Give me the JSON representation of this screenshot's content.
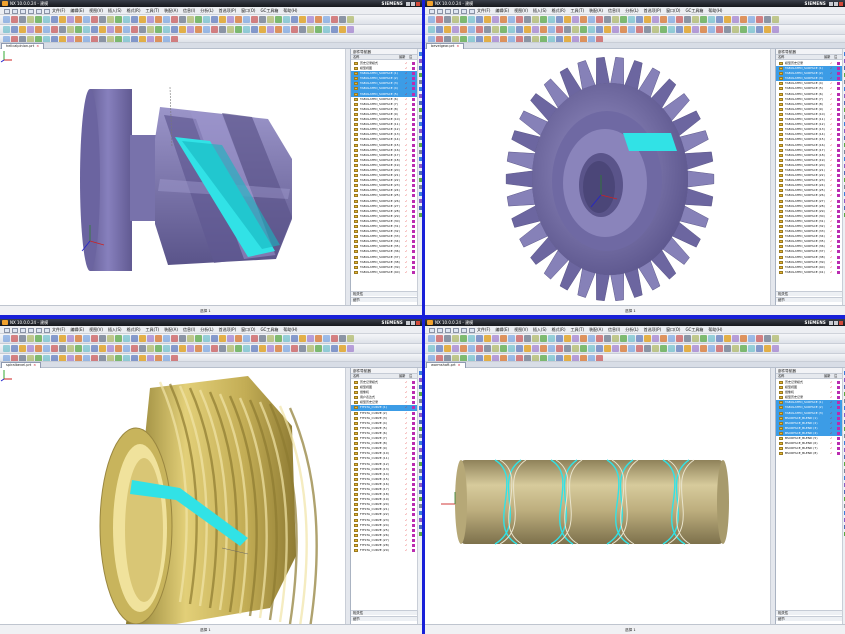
{
  "app": {
    "title": "NX 10.0.0.24 - 建模",
    "brand": "SIEMENS",
    "menus": [
      "文件(F)",
      "编辑(E)",
      "视图(V)",
      "插入(S)",
      "格式(R)",
      "工具(T)",
      "装配(A)",
      "信息(I)",
      "分析(L)",
      "首选项(P)",
      "窗口(O)",
      "GC工具箱",
      "帮助(H)"
    ]
  },
  "panels": [
    {
      "id": "helical-pinion",
      "tab": "helicalpinion.prt",
      "status_message": "",
      "status_count": "选择 1",
      "nav_header": "部件导航器",
      "nav_cols": [
        "名称",
        "最新",
        "注"
      ],
      "nav_rows": [
        {
          "label": "历史记录模式",
          "sel": false
        },
        {
          "label": "模型视图",
          "sel": false
        },
        {
          "label": "TABULATED_SURFACE (1)",
          "sel": true
        },
        {
          "label": "TABULATED_SURFACE (2)",
          "sel": true
        },
        {
          "label": "TABULATED_SURFACE (3)",
          "sel": true
        },
        {
          "label": "TABULATED_SURFACE (4)",
          "sel": true
        },
        {
          "label": "TABULATED_SURFACE (5)",
          "sel": true
        },
        {
          "label": "TABULATED_SURFACE (6)",
          "sel": false
        },
        {
          "label": "TABULATED_SURFACE (7)",
          "sel": false
        },
        {
          "label": "TABULATED_SURFACE (8)",
          "sel": false
        },
        {
          "label": "TABULATED_SURFACE (9)",
          "sel": false
        },
        {
          "label": "TABULATED_SURFACE (10)",
          "sel": false
        },
        {
          "label": "TABULATED_SURFACE (11)",
          "sel": false
        },
        {
          "label": "TABULATED_SURFACE (12)",
          "sel": false
        },
        {
          "label": "TABULATED_SURFACE (13)",
          "sel": false
        },
        {
          "label": "TABULATED_SURFACE (14)",
          "sel": false
        },
        {
          "label": "TABULATED_SURFACE (15)",
          "sel": false
        },
        {
          "label": "TABULATED_SURFACE (16)",
          "sel": false
        },
        {
          "label": "TABULATED_SURFACE (17)",
          "sel": false
        },
        {
          "label": "TABULATED_SURFACE (18)",
          "sel": false
        },
        {
          "label": "TABULATED_SURFACE (19)",
          "sel": false
        },
        {
          "label": "TABULATED_SURFACE (20)",
          "sel": false
        },
        {
          "label": "TABULATED_SURFACE (21)",
          "sel": false
        },
        {
          "label": "TABULATED_SURFACE (22)",
          "sel": false
        },
        {
          "label": "TABULATED_SURFACE (23)",
          "sel": false
        },
        {
          "label": "TABULATED_SURFACE (24)",
          "sel": false
        },
        {
          "label": "TABULATED_SURFACE (25)",
          "sel": false
        },
        {
          "label": "TABULATED_SURFACE (26)",
          "sel": false
        },
        {
          "label": "TABULATED_SURFACE (27)",
          "sel": false
        },
        {
          "label": "TABULATED_SURFACE (28)",
          "sel": false
        },
        {
          "label": "TABULATED_SURFACE (29)",
          "sel": false
        },
        {
          "label": "TABULATED_SURFACE (30)",
          "sel": false
        },
        {
          "label": "TABULATED_SURFACE (31)",
          "sel": false
        },
        {
          "label": "TABULATED_SURFACE (32)",
          "sel": false
        },
        {
          "label": "TABULATED_SURFACE (33)",
          "sel": false
        },
        {
          "label": "TABULATED_SURFACE (34)",
          "sel": false
        },
        {
          "label": "TABULATED_SURFACE (35)",
          "sel": false
        },
        {
          "label": "TABULATED_SURFACE (36)",
          "sel": false
        },
        {
          "label": "TABULATED_SURFACE (37)",
          "sel": false
        },
        {
          "label": "TABULATED_SURFACE (38)",
          "sel": false
        },
        {
          "label": "TABULATED_SURFACE (39)",
          "sel": false
        },
        {
          "label": "TABULATED_SURFACE (40)",
          "sel": false
        }
      ],
      "foot": [
        "相关性",
        "细节"
      ]
    },
    {
      "id": "bevel-gear",
      "tab": "bevelgear.prt",
      "status_message": "",
      "status_count": "选择 1",
      "nav_header": "部件导航器",
      "nav_cols": [
        "名称",
        "最新",
        "注"
      ],
      "nav_rows": [
        {
          "label": "模型历史记录",
          "sel": false
        },
        {
          "label": "TABULATED_SURFACE (1)",
          "sel": true
        },
        {
          "label": "TABULATED_SURFACE (2)",
          "sel": true
        },
        {
          "label": "TABULATED_SURFACE (3)",
          "sel": true
        },
        {
          "label": "TABULATED_SURFACE (4)",
          "sel": false
        },
        {
          "label": "TABULATED_SURFACE (5)",
          "sel": false
        },
        {
          "label": "TABULATED_SURFACE (6)",
          "sel": false
        },
        {
          "label": "TABULATED_SURFACE (7)",
          "sel": false
        },
        {
          "label": "TABULATED_SURFACE (8)",
          "sel": false
        },
        {
          "label": "TABULATED_SURFACE (9)",
          "sel": false
        },
        {
          "label": "TABULATED_SURFACE (10)",
          "sel": false
        },
        {
          "label": "TABULATED_SURFACE (11)",
          "sel": false
        },
        {
          "label": "TABULATED_SURFACE (12)",
          "sel": false
        },
        {
          "label": "TABULATED_SURFACE (13)",
          "sel": false
        },
        {
          "label": "TABULATED_SURFACE (14)",
          "sel": false
        },
        {
          "label": "TABULATED_SURFACE (15)",
          "sel": false
        },
        {
          "label": "TABULATED_SURFACE (16)",
          "sel": false
        },
        {
          "label": "TABULATED_SURFACE (17)",
          "sel": false
        },
        {
          "label": "TABULATED_SURFACE (18)",
          "sel": false
        },
        {
          "label": "TABULATED_SURFACE (19)",
          "sel": false
        },
        {
          "label": "TABULATED_SURFACE (20)",
          "sel": false
        },
        {
          "label": "TABULATED_SURFACE (21)",
          "sel": false
        },
        {
          "label": "TABULATED_SURFACE (22)",
          "sel": false
        },
        {
          "label": "TABULATED_SURFACE (23)",
          "sel": false
        },
        {
          "label": "TABULATED_SURFACE (24)",
          "sel": false
        },
        {
          "label": "TABULATED_SURFACE (25)",
          "sel": false
        },
        {
          "label": "TABULATED_SURFACE (26)",
          "sel": false
        },
        {
          "label": "TABULATED_SURFACE (27)",
          "sel": false
        },
        {
          "label": "TABULATED_SURFACE (28)",
          "sel": false
        },
        {
          "label": "TABULATED_SURFACE (29)",
          "sel": false
        },
        {
          "label": "TABULATED_SURFACE (30)",
          "sel": false
        },
        {
          "label": "TABULATED_SURFACE (31)",
          "sel": false
        },
        {
          "label": "TABULATED_SURFACE (32)",
          "sel": false
        },
        {
          "label": "TABULATED_SURFACE (33)",
          "sel": false
        },
        {
          "label": "TABULATED_SURFACE (34)",
          "sel": false
        },
        {
          "label": "TABULATED_SURFACE (35)",
          "sel": false
        },
        {
          "label": "TABULATED_SURFACE (36)",
          "sel": false
        },
        {
          "label": "TABULATED_SURFACE (37)",
          "sel": false
        },
        {
          "label": "TABULATED_SURFACE (38)",
          "sel": false
        },
        {
          "label": "TABULATED_SURFACE (39)",
          "sel": false
        },
        {
          "label": "TABULATED_SURFACE (40)",
          "sel": false
        },
        {
          "label": "TABULATED_SURFACE (41)",
          "sel": false
        }
      ],
      "foot": [
        "相关性",
        "细节"
      ]
    },
    {
      "id": "spiral-bevel",
      "tab": "spiralbevel.prt",
      "status_message": "",
      "status_count": "选择 1",
      "nav_header": "部件导航器",
      "nav_cols": [
        "名称",
        "最新",
        "注"
      ],
      "nav_rows": [
        {
          "label": "历史记录模式",
          "sel": false
        },
        {
          "label": "模型视图",
          "sel": false
        },
        {
          "label": "摄像机",
          "sel": false
        },
        {
          "label": "用户表达式",
          "sel": false
        },
        {
          "label": "模型历史记录",
          "sel": false
        },
        {
          "label": "FITSTA_CURVE (1)",
          "sel": true
        },
        {
          "label": "FITSTA_CURVE (2)",
          "sel": false
        },
        {
          "label": "FITSTA_CURVE (3)",
          "sel": false
        },
        {
          "label": "FITSTA_CURVE (4)",
          "sel": false
        },
        {
          "label": "FITSTA_CURVE (5)",
          "sel": false
        },
        {
          "label": "FITSTA_CURVE (6)",
          "sel": false
        },
        {
          "label": "FITSTA_CURVE (7)",
          "sel": false
        },
        {
          "label": "FITSTA_CURVE (8)",
          "sel": false
        },
        {
          "label": "FITSTA_CURVE (9)",
          "sel": false
        },
        {
          "label": "FITSTA_CURVE (10)",
          "sel": false
        },
        {
          "label": "FITSTA_CURVE (11)",
          "sel": false
        },
        {
          "label": "FITSTA_CURVE (12)",
          "sel": false
        },
        {
          "label": "FITSTA_CURVE (13)",
          "sel": false
        },
        {
          "label": "FITSTA_CURVE (14)",
          "sel": false
        },
        {
          "label": "FITSTA_CURVE (15)",
          "sel": false
        },
        {
          "label": "FITSTA_CURVE (16)",
          "sel": false
        },
        {
          "label": "FITSTA_CURVE (17)",
          "sel": false
        },
        {
          "label": "FITSTA_CURVE (18)",
          "sel": false
        },
        {
          "label": "FITSTA_CURVE (19)",
          "sel": false
        },
        {
          "label": "FITSTA_CURVE (20)",
          "sel": false
        },
        {
          "label": "FITSTA_CURVE (21)",
          "sel": false
        },
        {
          "label": "FITSTA_CURVE (22)",
          "sel": false
        },
        {
          "label": "FITSTA_CURVE (23)",
          "sel": false
        },
        {
          "label": "FITSTA_CURVE (24)",
          "sel": false
        },
        {
          "label": "FITSTA_CURVE (25)",
          "sel": false
        },
        {
          "label": "FITSTA_CURVE (26)",
          "sel": false
        },
        {
          "label": "FITSTA_CURVE (27)",
          "sel": false
        },
        {
          "label": "FITSTA_CURVE (28)",
          "sel": false
        },
        {
          "label": "FITSTA_CURVE (29)",
          "sel": false
        }
      ],
      "foot": [
        "相关性",
        "细节"
      ]
    },
    {
      "id": "worm-shaft",
      "tab": "wormshaft.prt",
      "status_message": "",
      "status_count": "选择 1",
      "nav_header": "部件导航器",
      "nav_cols": [
        "名称",
        "最新",
        "注"
      ],
      "nav_rows": [
        {
          "label": "历史记录模式",
          "sel": false
        },
        {
          "label": "模型视图",
          "sel": false
        },
        {
          "label": "摄像机",
          "sel": false
        },
        {
          "label": "模型历史记录",
          "sel": false
        },
        {
          "label": "TABULATED_SURFACE (1)",
          "sel": true
        },
        {
          "label": "TABULATED_SURFACE (2)",
          "sel": true
        },
        {
          "label": "TABULATED_SURFACE (3)",
          "sel": true
        },
        {
          "label": "BSURFACE_BLEND (1)",
          "sel": true
        },
        {
          "label": "BSURFACE_BLEND (2)",
          "sel": true
        },
        {
          "label": "BSURFACE_BLEND (3)",
          "sel": true
        },
        {
          "label": "BSURFACE_BLEND (4)",
          "sel": true
        },
        {
          "label": "BSURFACE_BLEND (5)",
          "sel": false
        },
        {
          "label": "BSURFACE_BLEND (6)",
          "sel": false
        },
        {
          "label": "BSURFACE_BLEND (7)",
          "sel": false
        },
        {
          "label": "BSURFACE_BLEND (8)",
          "sel": false
        }
      ],
      "foot": [
        "相关性",
        "细节"
      ]
    }
  ],
  "colors": {
    "gear_purple": "#7a73ad",
    "gear_gold": "#c9b35a",
    "highlight_cyan": "#31e2e6",
    "worm_tan": "#bdae7e",
    "selection_blue": "#3c9ce6",
    "frame_blue": "#1820d8"
  }
}
